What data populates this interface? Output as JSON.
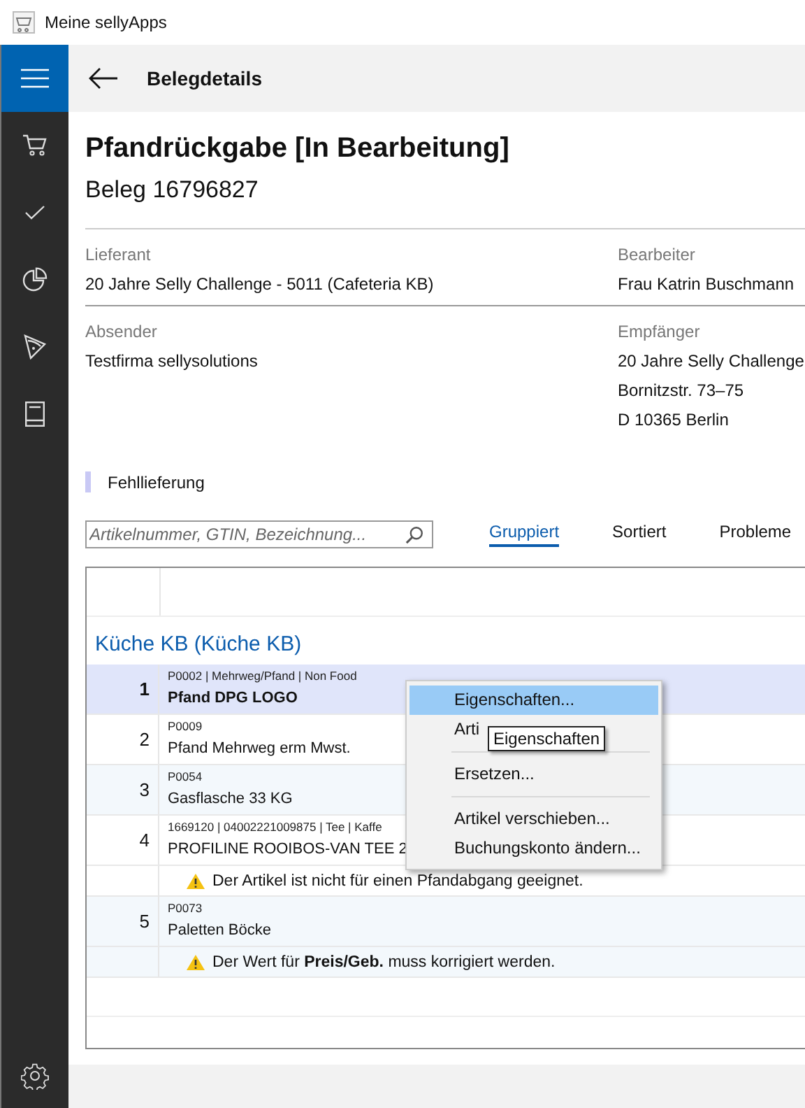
{
  "window": {
    "title": "Meine sellyApps"
  },
  "header": {
    "title": "Belegdetails"
  },
  "document": {
    "title": "Pfandrückgabe [In Bearbeitung]",
    "subtitle": "Beleg 16796827"
  },
  "details": [
    {
      "left": {
        "label": "Lieferant",
        "lines": [
          "20 Jahre Selly Challenge - 5011 (Cafeteria KB)"
        ]
      },
      "right": {
        "label": "Bearbeiter",
        "lines": [
          "Frau Katrin Buschmann"
        ]
      }
    },
    {
      "left": {
        "label": "Absender",
        "lines": [
          "Testfirma sellysolutions"
        ]
      },
      "right": {
        "label": "Empfänger",
        "lines": [
          "20 Jahre Selly Challenge",
          "Bornitzstr. 73–75",
          "D 10365 Berlin"
        ]
      }
    }
  ],
  "tag": {
    "label": "Fehllieferung"
  },
  "search": {
    "placeholder": "Artikelnummer, GTIN, Bezeichnung..."
  },
  "view_tabs": [
    {
      "label": "Gruppiert",
      "selected": true
    },
    {
      "label": "Sortiert",
      "selected": false
    },
    {
      "label": "Probleme",
      "selected": false
    }
  ],
  "table": {
    "groups": [
      {
        "title": "Küche KB (Küche KB)",
        "rows": [
          {
            "number": "1",
            "meta": "P0002 | Mehrweg/Pfand | Non Food",
            "name": "Pfand DPG LOGO",
            "selected": true
          },
          {
            "number": "2",
            "meta": "P0009",
            "name": "Pfand Mehrweg erm Mwst.",
            "selected": false
          },
          {
            "number": "3",
            "meta": "P0054",
            "name": "Gasflasche 33 KG",
            "selected": false
          },
          {
            "number": "4",
            "meta": "1669120 | 04002221009875 | Tee | Kaffe",
            "name": "PROFILINE ROOIBOS-VAN TEE 2",
            "selected": false,
            "warning": "Der Artikel ist nicht für einen Pfandabgang geeignet."
          },
          {
            "number": "5",
            "meta": "P0073",
            "name": "Paletten Böcke",
            "selected": false,
            "warning": "Der Wert für **Preis/Geb.** muss korrigiert werden."
          }
        ]
      }
    ]
  },
  "context_menu": {
    "items": [
      {
        "kind": "item",
        "label": "Eigenschaften...",
        "highlighted": true
      },
      {
        "kind": "item",
        "label": "Arti",
        "highlighted": false
      },
      {
        "kind": "separator"
      },
      {
        "kind": "item",
        "label": "Ersetzen...",
        "highlighted": false
      },
      {
        "kind": "separator"
      },
      {
        "kind": "item",
        "label": "Artikel verschieben...",
        "highlighted": false
      },
      {
        "kind": "item",
        "label": "Buchungskonto ändern...",
        "highlighted": false
      }
    ],
    "tooltip": "Eigenschaften"
  }
}
